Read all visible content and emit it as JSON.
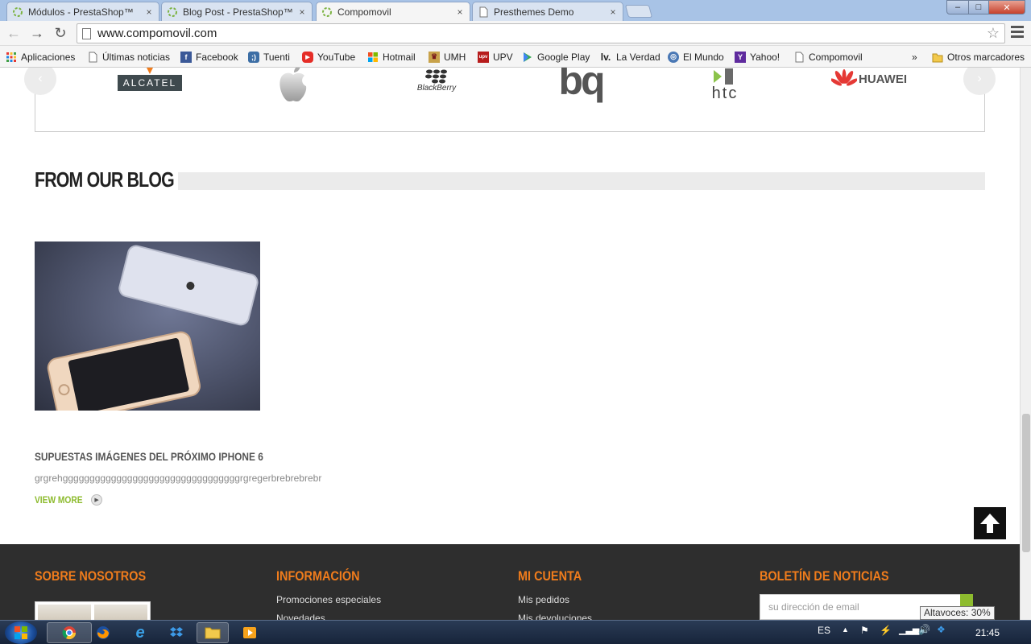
{
  "browser": {
    "tabs": [
      {
        "title": "Módulos - PrestaShop™",
        "icon": "prestashop-favicon"
      },
      {
        "title": "Blog Post - PrestaShop™",
        "icon": "prestashop-favicon"
      },
      {
        "title": "Compomovil",
        "icon": "prestashop-favicon",
        "active": true
      },
      {
        "title": "Presthemes Demo",
        "icon": "page-icon"
      }
    ],
    "close_glyph": "×",
    "window_controls": {
      "minimize": "–",
      "maximize": "□",
      "close": "✕"
    },
    "url": "www.compomovil.com",
    "bookmarks": [
      {
        "label": "Aplicaciones",
        "icon": "apps-grid-icon"
      },
      {
        "label": "Últimas noticias",
        "icon": "page-icon"
      },
      {
        "label": "Facebook",
        "icon": "facebook-icon"
      },
      {
        "label": "Tuenti",
        "icon": "tuenti-icon"
      },
      {
        "label": "YouTube",
        "icon": "youtube-icon"
      },
      {
        "label": "Hotmail",
        "icon": "windows-icon"
      },
      {
        "label": "UMH",
        "icon": "umh-icon"
      },
      {
        "label": "UPV",
        "icon": "upv-icon"
      },
      {
        "label": "Google Play",
        "icon": "google-play-icon"
      },
      {
        "label": "La Verdad",
        "icon": "la-verdad-icon"
      },
      {
        "label": "El Mundo",
        "icon": "el-mundo-icon"
      },
      {
        "label": "Yahoo!",
        "icon": "yahoo-icon"
      },
      {
        "label": "Compomovil",
        "icon": "page-icon"
      }
    ],
    "bookmarks_overflow": "»",
    "other_bookmarks": "Otros marcadores"
  },
  "page": {
    "brands": [
      "ALCATEL",
      "Apple",
      "BlackBerry",
      "bq",
      "htc",
      "HUAWEI"
    ],
    "blog_section_title": "FROM OUR BLOG",
    "post": {
      "title": "SUPUESTAS IMÁGENES DEL PRÓXIMO IPHONE 6",
      "excerpt": "grgrehgggggggggggggggggggggggggggggggggrgregerbrebrebrebr",
      "view_more": "VIEW MORE"
    },
    "footer": {
      "columns": [
        {
          "heading": "SOBRE NOSOTROS",
          "links": []
        },
        {
          "heading": "INFORMACIÓN",
          "links": [
            "Promociones especiales",
            "Novedades"
          ]
        },
        {
          "heading": "MI CUENTA",
          "links": [
            "Mis pedidos",
            "Mis devoluciones"
          ]
        },
        {
          "heading": "BOLETÍN DE NOTICIAS",
          "links": []
        }
      ],
      "newsletter_placeholder": "su dirección de email"
    },
    "colors": {
      "accent_orange": "#f07c1c",
      "accent_green": "#8dbb2e",
      "footer_bg": "#2e2e2e"
    }
  },
  "taskbar": {
    "language": "ES",
    "clock": "21:45",
    "tooltip": "Altavoces: 30%"
  }
}
